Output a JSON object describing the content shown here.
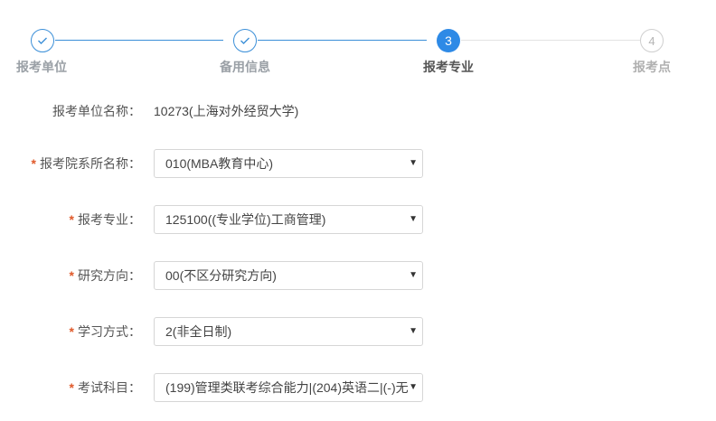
{
  "stepper": {
    "steps": [
      {
        "label": "报考单位",
        "state": "done",
        "number": "1"
      },
      {
        "label": "备用信息",
        "state": "done",
        "number": "2"
      },
      {
        "label": "报考专业",
        "state": "active",
        "number": "3"
      },
      {
        "label": "报考点",
        "state": "todo",
        "number": "4"
      }
    ],
    "colors": {
      "accent": "#2e8ae6",
      "done_line": "#3b8fd8",
      "todo": "#cfcfcf"
    }
  },
  "form": {
    "unit": {
      "label": "报考单位名称：",
      "value": "10273(上海对外经贸大学)"
    },
    "department": {
      "required_mark": "*",
      "label": "报考院系所名称：",
      "selected": "010(MBA教育中心)"
    },
    "major": {
      "required_mark": "*",
      "label": "报考专业：",
      "selected": "125100((专业学位)工商管理)"
    },
    "direction": {
      "required_mark": "*",
      "label": "研究方向：",
      "selected": "00(不区分研究方向)"
    },
    "study_mode": {
      "required_mark": "*",
      "label": "学习方式：",
      "selected": "2(非全日制)"
    },
    "subjects": {
      "required_mark": "*",
      "label": "考试科目：",
      "selected": "(199)管理类联考综合能力|(204)英语二|(-)无"
    }
  },
  "icons": {
    "check": "check-icon",
    "dropdown": "caret-down-icon"
  }
}
